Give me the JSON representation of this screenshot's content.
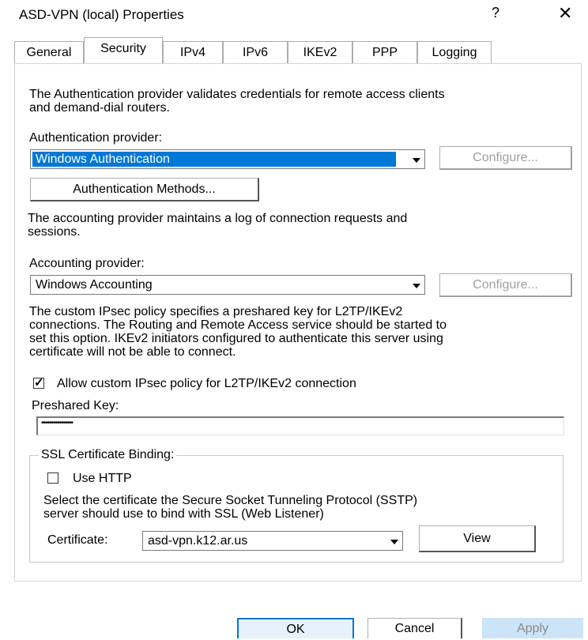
{
  "window": {
    "title": "ASD-VPN (local) Properties",
    "help_glyph": "?",
    "close_glyph": "✕"
  },
  "tabs": [
    {
      "label": "General",
      "active": false
    },
    {
      "label": "Security",
      "active": true
    },
    {
      "label": "IPv4",
      "active": false
    },
    {
      "label": "IPv6",
      "active": false
    },
    {
      "label": "IKEv2",
      "active": false
    },
    {
      "label": "PPP",
      "active": false
    },
    {
      "label": "Logging",
      "active": false
    }
  ],
  "security": {
    "auth_description_line1": "The Authentication provider validates credentials for remote access clients",
    "auth_description_line2": "and demand-dial routers.",
    "auth_provider_label": "Authentication provider:",
    "auth_provider_value": "Windows Authentication",
    "auth_configure_label": "Configure...",
    "auth_methods_label": "Authentication Methods...",
    "acct_description_line1": "The accounting provider maintains a log of connection requests and",
    "acct_description_line2": "sessions.",
    "acct_provider_label": "Accounting provider:",
    "acct_provider_value": "Windows Accounting",
    "acct_configure_label": "Configure...",
    "ipsec_line1": "The custom IPsec policy specifies a preshared key for L2TP/IKEv2",
    "ipsec_line2": "connections. The Routing and Remote Access service should be started to",
    "ipsec_line3": "set this option. IKEv2 initiators configured to authenticate this server using",
    "ipsec_line4": "certificate will not be able to connect.",
    "allow_ipsec_label": "Allow custom IPsec policy for L2TP/IKEv2 connection",
    "allow_ipsec_checked": true,
    "preshared_key_label": "Preshared Key:",
    "preshared_key_value": "••••••••••••••••"
  },
  "ssl": {
    "group_label": "SSL Certificate Binding:",
    "use_http_label": "Use HTTP",
    "use_http_checked": false,
    "desc_line1": "Select the certificate the Secure Socket Tunneling Protocol (SSTP)",
    "desc_line2": "server should use to bind with SSL (Web Listener)",
    "certificate_label": "Certificate:",
    "certificate_value": "asd-vpn.k12.ar.us",
    "view_label": "View"
  },
  "footer": {
    "ok_label": "OK",
    "cancel_label": "Cancel",
    "apply_label": "Apply"
  },
  "colors": {
    "selection": "#0078d7",
    "primary_button_bg": "#e5f1fb",
    "apply_bg": "#cce4f7"
  }
}
